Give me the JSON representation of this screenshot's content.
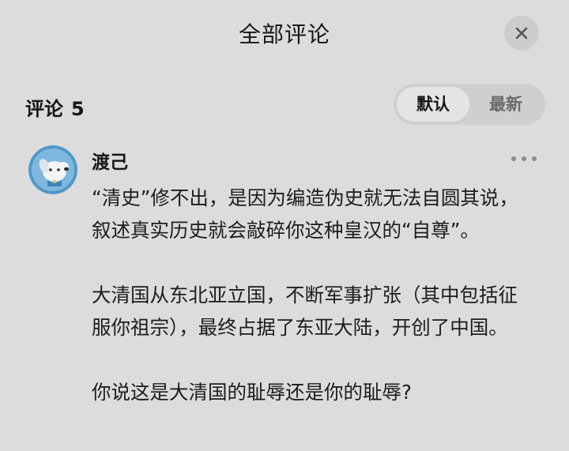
{
  "header": {
    "title": "全部评论",
    "close_icon": "close-icon"
  },
  "comments_section": {
    "label": "评论",
    "count": "5",
    "sort_options": [
      {
        "label": "默认",
        "active": true
      },
      {
        "label": "最新",
        "active": false
      }
    ]
  },
  "comment": {
    "avatar_icon": "dog-avatar-icon",
    "username": "渡己",
    "more_icon": "more-dots-icon",
    "paragraphs": [
      "“清史”修不出，是因为编造伪史就无法自圆其说，叙述真实历史就会敲碎你这种皇汉的“自尊”。",
      "大清国从东北亚立国，不断军事扩张（其中包括征服你祖宗），最终占据了东亚大陆，开创了中国。",
      "你说这是大清国的耻辱还是你的耻辱?"
    ]
  },
  "colors": {
    "background": "#dcdcdc",
    "toggle_bg": "#cfcfcf",
    "toggle_active": "#e4e4e4",
    "avatar_bg": "#4f98c9"
  }
}
